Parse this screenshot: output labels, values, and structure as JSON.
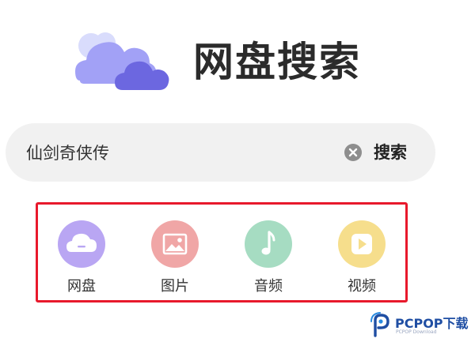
{
  "app": {
    "title": "网盘搜索",
    "logo_icon": "cloud-icon",
    "colors": {
      "cloud_light": "#cfd2fb",
      "cloud_mid": "#9f9ff5",
      "cloud_dark": "#6b66e0",
      "title": "#2b2b2b"
    }
  },
  "search": {
    "value": "仙剑奇侠传",
    "clear_icon": "clear-icon",
    "button_label": "搜索",
    "background": "#f1f1f1"
  },
  "categories": {
    "highlight_color": "#e8192c",
    "items": [
      {
        "label": "网盘",
        "icon": "cloud-drive-icon",
        "color": "#b9a6f3"
      },
      {
        "label": "图片",
        "icon": "image-icon",
        "color": "#f0a6a6"
      },
      {
        "label": "音频",
        "icon": "music-note-icon",
        "color": "#a6dcc2"
      },
      {
        "label": "视频",
        "icon": "play-icon",
        "color": "#f6de8c"
      }
    ]
  },
  "watermark": {
    "brand": "PCPOP下载",
    "tagline": "PCPOP Download",
    "logo_icon": "pcpop-logo-icon",
    "color": "#1f4ea3"
  }
}
